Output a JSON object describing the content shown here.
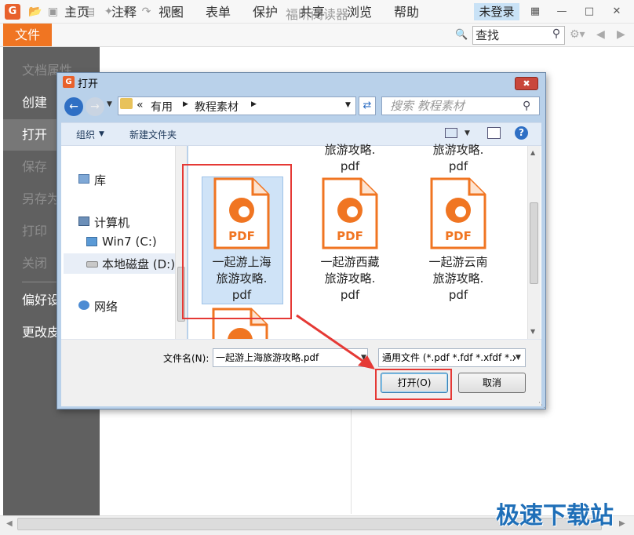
{
  "app": {
    "logo_letter": "G",
    "title": "福昕阅读器",
    "login": "未登录",
    "accent_color": "#f07522"
  },
  "menu": {
    "file": "文件",
    "items": [
      "主页",
      "注释",
      "视图",
      "表单",
      "保护",
      "共享",
      "浏览",
      "帮助"
    ],
    "find_placeholder": "查找"
  },
  "left_panel": {
    "items": [
      "文档属性",
      "创建",
      "打开",
      "保存",
      "另存为",
      "打印",
      "关闭",
      "偏好设置",
      "更改皮肤"
    ],
    "active": "打开"
  },
  "dialog": {
    "title": "打开",
    "breadcrumb": [
      "«",
      "有用",
      "教程素材"
    ],
    "search_placeholder": "搜索 教程素材",
    "organize": "组织",
    "new_folder": "新建文件夹",
    "nav": {
      "library": "库",
      "computer": "计算机",
      "drive_c": "Win7 (C:)",
      "drive_d": "本地磁盘 (D:)",
      "network": "网络"
    },
    "files_top": [
      {
        "line1": "旅游攻略.",
        "line2": "pdf"
      },
      {
        "line1": "旅游攻略.",
        "line2": "pdf"
      }
    ],
    "files": [
      {
        "name_lines": [
          "一起游上海",
          "旅游攻略.",
          "pdf"
        ],
        "selected": true
      },
      {
        "name_lines": [
          "一起游西藏",
          "旅游攻略.",
          "pdf"
        ],
        "selected": false
      },
      {
        "name_lines": [
          "一起游云南",
          "旅游攻略.",
          "pdf"
        ],
        "selected": false
      }
    ],
    "pdf_label": "PDF",
    "filename_label": "文件名(N):",
    "filename_value": "一起游上海旅游攻略.pdf",
    "filetype_value": "通用文件 (*.pdf *.fdf *.xfdf *.x",
    "open_button": "打开(O)",
    "cancel_button": "取消"
  },
  "watermark": "极速下载站",
  "highlight_color": "#e53935"
}
